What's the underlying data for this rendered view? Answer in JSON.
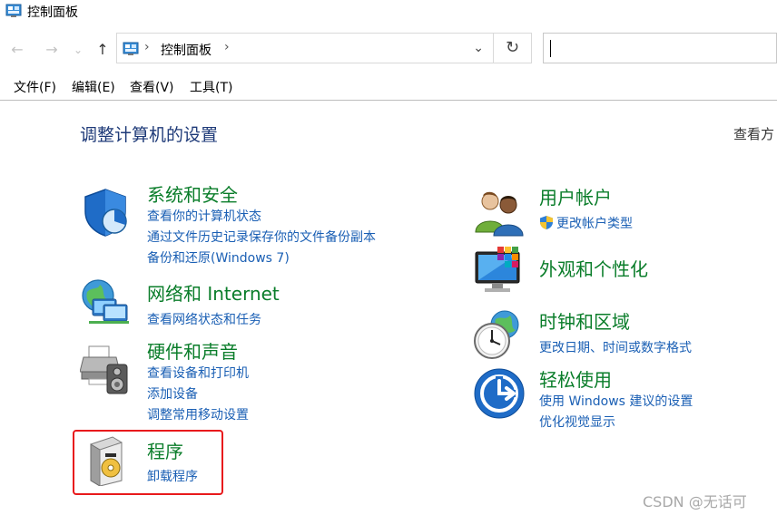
{
  "window": {
    "title": "控制面板"
  },
  "navigation": {
    "back_glyph": "←",
    "forward_glyph": "→",
    "recent_glyph": "⌄",
    "up_glyph": "↑",
    "address_separator": "›",
    "address_path": "控制面板",
    "address_trailing_separator": "›",
    "dropdown_glyph": "⌄",
    "refresh_glyph": "↻",
    "search_value": ""
  },
  "menubar": {
    "items": [
      "文件(F)",
      "编辑(E)",
      "查看(V)",
      "工具(T)"
    ]
  },
  "main": {
    "title": "调整计算机的设置",
    "view_by_label": "查看方"
  },
  "categories": {
    "system": {
      "title": "系统和安全",
      "links": [
        "查看你的计算机状态",
        "通过文件历史记录保存你的文件备份副本",
        "备份和还原(Windows 7)"
      ]
    },
    "network": {
      "title": "网络和 Internet",
      "links": [
        "查看网络状态和任务"
      ]
    },
    "hardware": {
      "title": "硬件和声音",
      "links": [
        "查看设备和打印机",
        "添加设备",
        "调整常用移动设置"
      ]
    },
    "programs": {
      "title": "程序",
      "links": [
        "卸载程序"
      ]
    },
    "accounts": {
      "title": "用户帐户",
      "links": [
        "更改帐户类型"
      ]
    },
    "appearance": {
      "title": "外观和个性化",
      "links": []
    },
    "clock": {
      "title": "时钟和区域",
      "links": [
        "更改日期、时间或数字格式"
      ]
    },
    "ease": {
      "title": "轻松使用",
      "links": [
        "使用 Windows 建议的设置",
        "优化视觉显示"
      ]
    }
  },
  "watermark": "CSDN @无话可",
  "colors": {
    "category_title": "#0a7d2a",
    "link": "#1a5fb4",
    "page_title": "#1e3a78",
    "highlight_border": "#e8191c"
  },
  "icons": {
    "window": "control-panel-icon",
    "system": "security-shield-icon",
    "network": "network-globe-icon",
    "hardware": "printer-speaker-icon",
    "programs": "program-box-icon",
    "accounts": "users-icon",
    "appearance": "monitor-palette-icon",
    "clock": "clock-globe-icon",
    "ease": "ease-of-access-icon",
    "uac": "uac-shield-icon"
  }
}
